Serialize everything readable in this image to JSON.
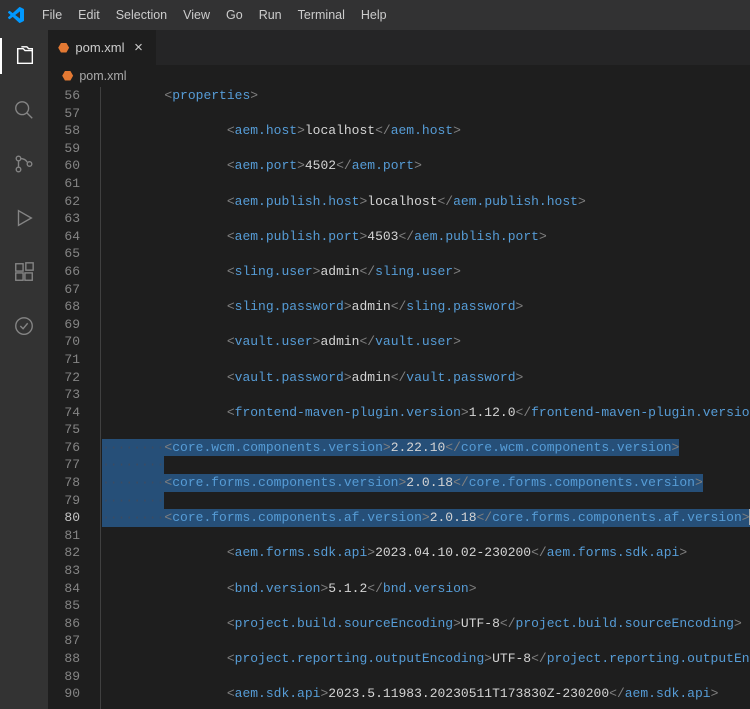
{
  "menubar": [
    "File",
    "Edit",
    "Selection",
    "View",
    "Go",
    "Run",
    "Terminal",
    "Help"
  ],
  "activity_bar": [
    {
      "name": "explorer-icon",
      "active": true
    },
    {
      "name": "search-icon",
      "active": false
    },
    {
      "name": "source-control-icon",
      "active": false
    },
    {
      "name": "run-debug-icon",
      "active": false
    },
    {
      "name": "extensions-icon",
      "active": false
    },
    {
      "name": "test-icon",
      "active": false
    }
  ],
  "tab": {
    "filename": "pom.xml",
    "icon": "xml-file-icon"
  },
  "breadcrumb": {
    "filename": "pom.xml",
    "icon": "xml-file-icon"
  },
  "code": {
    "first_line": 56,
    "current_line": 80,
    "lines": [
      {
        "n": 56,
        "indent": 1,
        "kind": "open",
        "tag": "properties"
      },
      {
        "n": 57,
        "indent": 0,
        "kind": "blank"
      },
      {
        "n": 58,
        "indent": 2,
        "kind": "leaf",
        "tag": "aem.host",
        "val": "localhost"
      },
      {
        "n": 59,
        "indent": 0,
        "kind": "blank"
      },
      {
        "n": 60,
        "indent": 2,
        "kind": "leaf",
        "tag": "aem.port",
        "val": "4502"
      },
      {
        "n": 61,
        "indent": 0,
        "kind": "blank"
      },
      {
        "n": 62,
        "indent": 2,
        "kind": "leaf",
        "tag": "aem.publish.host",
        "val": "localhost"
      },
      {
        "n": 63,
        "indent": 0,
        "kind": "blank"
      },
      {
        "n": 64,
        "indent": 2,
        "kind": "leaf",
        "tag": "aem.publish.port",
        "val": "4503"
      },
      {
        "n": 65,
        "indent": 0,
        "kind": "blank"
      },
      {
        "n": 66,
        "indent": 2,
        "kind": "leaf",
        "tag": "sling.user",
        "val": "admin"
      },
      {
        "n": 67,
        "indent": 0,
        "kind": "blank"
      },
      {
        "n": 68,
        "indent": 2,
        "kind": "leaf",
        "tag": "sling.password",
        "val": "admin"
      },
      {
        "n": 69,
        "indent": 0,
        "kind": "blank"
      },
      {
        "n": 70,
        "indent": 2,
        "kind": "leaf",
        "tag": "vault.user",
        "val": "admin"
      },
      {
        "n": 71,
        "indent": 0,
        "kind": "blank"
      },
      {
        "n": 72,
        "indent": 2,
        "kind": "leaf",
        "tag": "vault.password",
        "val": "admin"
      },
      {
        "n": 73,
        "indent": 0,
        "kind": "blank"
      },
      {
        "n": 74,
        "indent": 2,
        "kind": "leaf",
        "tag": "frontend-maven-plugin.version",
        "val": "1.12.0"
      },
      {
        "n": 75,
        "indent": 0,
        "kind": "blank"
      },
      {
        "n": 76,
        "indent": 2,
        "kind": "leaf",
        "tag": "core.wcm.components.version",
        "val": "2.22.10",
        "selected": true,
        "show_ws": true
      },
      {
        "n": 77,
        "indent": 2,
        "kind": "ws_only",
        "selected": true
      },
      {
        "n": 78,
        "indent": 2,
        "kind": "leaf",
        "tag": "core.forms.components.version",
        "val": "2.0.18",
        "selected": true,
        "show_ws": true
      },
      {
        "n": 79,
        "indent": 2,
        "kind": "ws_only",
        "selected": true
      },
      {
        "n": 80,
        "indent": 2,
        "kind": "leaf",
        "tag": "core.forms.components.af.version",
        "val": "2.0.18",
        "selected": true,
        "show_ws": true,
        "cursor_after": true
      },
      {
        "n": 81,
        "indent": 0,
        "kind": "blank"
      },
      {
        "n": 82,
        "indent": 2,
        "kind": "leaf",
        "tag": "aem.forms.sdk.api",
        "val": "2023.04.10.02-230200"
      },
      {
        "n": 83,
        "indent": 0,
        "kind": "blank"
      },
      {
        "n": 84,
        "indent": 2,
        "kind": "leaf",
        "tag": "bnd.version",
        "val": "5.1.2"
      },
      {
        "n": 85,
        "indent": 0,
        "kind": "blank"
      },
      {
        "n": 86,
        "indent": 2,
        "kind": "leaf",
        "tag": "project.build.sourceEncoding",
        "val": "UTF-8"
      },
      {
        "n": 87,
        "indent": 0,
        "kind": "blank"
      },
      {
        "n": 88,
        "indent": 2,
        "kind": "leaf",
        "tag": "project.reporting.outputEncoding",
        "val": "UTF-8"
      },
      {
        "n": 89,
        "indent": 0,
        "kind": "blank"
      },
      {
        "n": 90,
        "indent": 2,
        "kind": "leaf",
        "tag": "aem.sdk.api",
        "val": "2023.5.11983.20230511T173830Z-230200"
      }
    ]
  }
}
